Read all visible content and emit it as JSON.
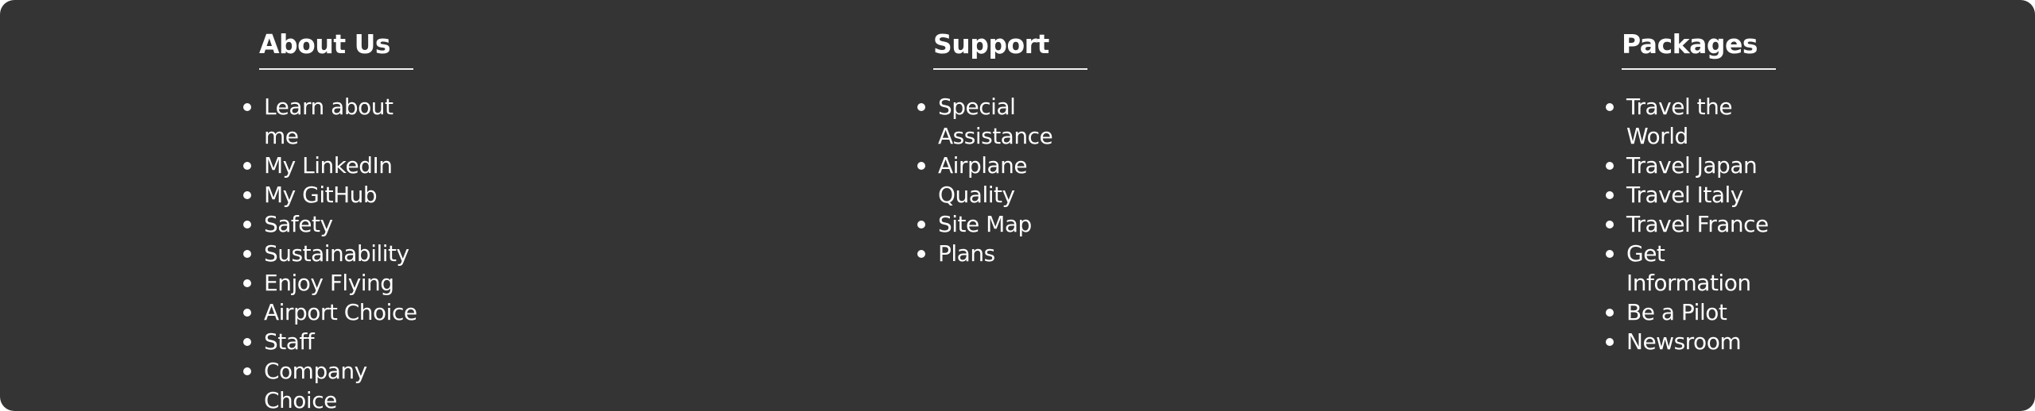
{
  "footer": {
    "about": {
      "title": "About Us",
      "items": [
        "Learn about me",
        "My LinkedIn",
        "My GitHub",
        "Safety",
        "Sustainability",
        "Enjoy Flying",
        "Airport Choice",
        "Staff",
        "Company Choice"
      ]
    },
    "support": {
      "title": "Support",
      "items": [
        "Special Assistance",
        "Airplane Quality",
        "Site Map",
        "Plans"
      ]
    },
    "packages": {
      "title": "Packages",
      "items": [
        "Travel the World",
        "Travel Japan",
        "Travel Italy",
        "Travel France",
        "Get Information",
        "Be a Pilot",
        "Newsroom"
      ]
    }
  }
}
